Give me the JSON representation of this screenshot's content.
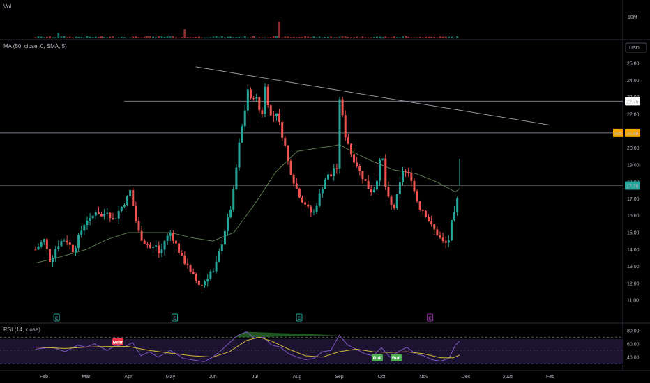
{
  "chart_data": {
    "type": "candlestick",
    "x_ticks": [
      "Feb",
      "Mar",
      "Apr",
      "May",
      "Jun",
      "Jul",
      "Aug",
      "Sep",
      "Oct",
      "Nov",
      "Dec",
      "2025",
      "Feb"
    ],
    "price_axis": {
      "unit_label": "USD",
      "ylim": [
        11.0,
        25.0
      ],
      "ticks": [
        "25.00",
        "24.00",
        "23.00",
        "22.00",
        "21.00",
        "20.00",
        "19.00",
        "18.00",
        "17.00",
        "16.00",
        "15.00",
        "14.00",
        "13.00",
        "12.00",
        "11.00"
      ]
    },
    "volume_pane": {
      "label": "Vol",
      "tick": "10M",
      "spikes_millions": [
        {
          "month_pos": 0.35,
          "value": 4.0
        },
        {
          "month_pos": 3.35,
          "value": 7.0
        },
        {
          "month_pos": 5.55,
          "value": 13.0
        },
        {
          "month_pos": 6.2,
          "value": 2.0
        },
        {
          "month_pos": 7.15,
          "value": 1.5
        },
        {
          "month_pos": 8.6,
          "value": 1.8
        }
      ]
    },
    "ma_legend": "MA (50, close, 0, SMA, 5)",
    "price_markers": [
      {
        "label": "22.76",
        "value": 22.76,
        "style": "white"
      },
      {
        "prefix": "Pre",
        "label": "20.89",
        "value": 20.89,
        "style": "orange"
      },
      {
        "label": "17.78",
        "value": 17.78,
        "style": "green"
      }
    ],
    "horizontal_lines": [
      22.76,
      20.89,
      17.78
    ],
    "trendline": {
      "start": {
        "month_pos": 3.6,
        "value": 24.8
      },
      "end": {
        "month_pos": 12.0,
        "value": 21.35
      }
    },
    "earnings_markers": [
      {
        "month_pos": 0.3,
        "label": "E",
        "color": "#26a69a"
      },
      {
        "month_pos": 3.1,
        "label": "E",
        "color": "#26a69a"
      },
      {
        "month_pos": 6.05,
        "label": "E",
        "color": "#26a69a"
      },
      {
        "month_pos": 9.15,
        "label": "E",
        "color": "#9c27b0"
      }
    ],
    "price_path": [
      [
        -0.2,
        14.0
      ],
      [
        0.0,
        14.6
      ],
      [
        0.15,
        13.3
      ],
      [
        0.3,
        14.2
      ],
      [
        0.45,
        14.6
      ],
      [
        0.55,
        14.5
      ],
      [
        0.7,
        13.9
      ],
      [
        0.85,
        14.9
      ],
      [
        1.0,
        15.8
      ],
      [
        1.1,
        15.7
      ],
      [
        1.25,
        16.4
      ],
      [
        1.35,
        15.9
      ],
      [
        1.5,
        16.3
      ],
      [
        1.65,
        15.7
      ],
      [
        1.8,
        16.4
      ],
      [
        1.95,
        16.9
      ],
      [
        2.05,
        17.5
      ],
      [
        2.15,
        16.0
      ],
      [
        2.25,
        15.0
      ],
      [
        2.35,
        14.5
      ],
      [
        2.45,
        14.3
      ],
      [
        2.55,
        14.0
      ],
      [
        2.65,
        14.3
      ],
      [
        2.75,
        13.6
      ],
      [
        2.85,
        14.5
      ],
      [
        3.0,
        15.0
      ],
      [
        3.1,
        14.5
      ],
      [
        3.2,
        13.9
      ],
      [
        3.3,
        13.3
      ],
      [
        3.4,
        13.2
      ],
      [
        3.45,
        12.6
      ],
      [
        3.55,
        12.4
      ],
      [
        3.65,
        12.0
      ],
      [
        3.75,
        11.9
      ],
      [
        3.85,
        12.3
      ],
      [
        3.95,
        12.7
      ],
      [
        4.05,
        12.6
      ],
      [
        4.1,
        13.4
      ],
      [
        4.2,
        14.2
      ],
      [
        4.3,
        15.3
      ],
      [
        4.4,
        16.1
      ],
      [
        4.5,
        17.5
      ],
      [
        4.6,
        19.7
      ],
      [
        4.65,
        20.6
      ],
      [
        4.75,
        22.0
      ],
      [
        4.85,
        23.8
      ],
      [
        4.9,
        22.8
      ],
      [
        5.0,
        23.2
      ],
      [
        5.1,
        22.3
      ],
      [
        5.15,
        21.6
      ],
      [
        5.25,
        23.8
      ],
      [
        5.3,
        22.8
      ],
      [
        5.4,
        21.6
      ],
      [
        5.5,
        22.3
      ],
      [
        5.6,
        21.2
      ],
      [
        5.7,
        20.3
      ],
      [
        5.8,
        19.0
      ],
      [
        5.9,
        18.2
      ],
      [
        6.0,
        17.5
      ],
      [
        6.1,
        17.0
      ],
      [
        6.2,
        16.7
      ],
      [
        6.3,
        16.2
      ],
      [
        6.4,
        16.2
      ],
      [
        6.5,
        17.0
      ],
      [
        6.6,
        17.7
      ],
      [
        6.7,
        18.4
      ],
      [
        6.8,
        18.3
      ],
      [
        6.85,
        18.9
      ],
      [
        6.95,
        18.6
      ],
      [
        7.0,
        23.0
      ],
      [
        7.05,
        22.7
      ],
      [
        7.1,
        21.0
      ],
      [
        7.2,
        20.4
      ],
      [
        7.3,
        19.5
      ],
      [
        7.4,
        19.1
      ],
      [
        7.5,
        18.5
      ],
      [
        7.6,
        18.1
      ],
      [
        7.7,
        17.6
      ],
      [
        7.8,
        17.4
      ],
      [
        7.9,
        18.3
      ],
      [
        8.0,
        19.7
      ],
      [
        8.05,
        19.0
      ],
      [
        8.1,
        17.6
      ],
      [
        8.2,
        16.6
      ],
      [
        8.3,
        16.5
      ],
      [
        8.4,
        17.4
      ],
      [
        8.5,
        18.7
      ],
      [
        8.6,
        18.5
      ],
      [
        8.7,
        18.3
      ],
      [
        8.8,
        17.2
      ],
      [
        8.9,
        16.5
      ],
      [
        9.0,
        16.3
      ],
      [
        9.1,
        15.8
      ],
      [
        9.2,
        15.3
      ],
      [
        9.3,
        15.0
      ],
      [
        9.4,
        14.6
      ],
      [
        9.5,
        14.3
      ],
      [
        9.6,
        14.6
      ],
      [
        9.65,
        15.5
      ],
      [
        9.75,
        16.2
      ],
      [
        9.85,
        17.78
      ]
    ],
    "ma_path": [
      [
        -0.2,
        13.2
      ],
      [
        0.3,
        13.5
      ],
      [
        1.0,
        14.0
      ],
      [
        1.5,
        14.6
      ],
      [
        2.0,
        15.0
      ],
      [
        2.5,
        15.0
      ],
      [
        3.0,
        15.0
      ],
      [
        3.5,
        14.7
      ],
      [
        4.0,
        14.5
      ],
      [
        4.5,
        15.0
      ],
      [
        5.0,
        16.7
      ],
      [
        5.5,
        18.6
      ],
      [
        6.0,
        19.8
      ],
      [
        6.5,
        20.0
      ],
      [
        6.8,
        20.1
      ],
      [
        7.0,
        20.2
      ],
      [
        7.3,
        19.8
      ],
      [
        7.8,
        19.2
      ],
      [
        8.3,
        18.7
      ],
      [
        8.8,
        18.5
      ],
      [
        9.3,
        18.0
      ],
      [
        9.75,
        17.4
      ],
      [
        9.85,
        17.6
      ]
    ],
    "rsi_pane": {
      "label": "RSI (14, close)",
      "ticks": [
        "80.00",
        "60.00",
        "40.00"
      ],
      "ylim": [
        20,
        90
      ],
      "bands": [
        70,
        30
      ],
      "badges": [
        {
          "month_pos": 1.75,
          "value": 63,
          "text": "Bear",
          "color": "#f23645"
        },
        {
          "month_pos": 7.9,
          "value": 39,
          "text": "Bull",
          "color": "#4caf50"
        },
        {
          "month_pos": 8.35,
          "value": 39,
          "text": "Bull",
          "color": "#4caf50"
        }
      ],
      "rsi_path": [
        [
          -0.2,
          52
        ],
        [
          0.2,
          55
        ],
        [
          0.5,
          48
        ],
        [
          0.8,
          58
        ],
        [
          1.0,
          55
        ],
        [
          1.2,
          60
        ],
        [
          1.5,
          50
        ],
        [
          1.7,
          58
        ],
        [
          1.9,
          55
        ],
        [
          2.1,
          62
        ],
        [
          2.3,
          42
        ],
        [
          2.5,
          48
        ],
        [
          2.7,
          40
        ],
        [
          3.0,
          50
        ],
        [
          3.3,
          38
        ],
        [
          3.6,
          35
        ],
        [
          3.8,
          33
        ],
        [
          4.0,
          40
        ],
        [
          4.2,
          50
        ],
        [
          4.4,
          62
        ],
        [
          4.6,
          73
        ],
        [
          4.8,
          78
        ],
        [
          5.0,
          68
        ],
        [
          5.2,
          70
        ],
        [
          5.4,
          58
        ],
        [
          5.6,
          55
        ],
        [
          5.8,
          45
        ],
        [
          6.0,
          40
        ],
        [
          6.2,
          36
        ],
        [
          6.4,
          38
        ],
        [
          6.6,
          48
        ],
        [
          6.8,
          50
        ],
        [
          7.0,
          73
        ],
        [
          7.2,
          58
        ],
        [
          7.4,
          52
        ],
        [
          7.6,
          45
        ],
        [
          7.8,
          42
        ],
        [
          8.0,
          54
        ],
        [
          8.2,
          40
        ],
        [
          8.4,
          48
        ],
        [
          8.6,
          55
        ],
        [
          8.8,
          45
        ],
        [
          9.0,
          42
        ],
        [
          9.2,
          36
        ],
        [
          9.4,
          34
        ],
        [
          9.6,
          38
        ],
        [
          9.75,
          58
        ],
        [
          9.85,
          64
        ]
      ],
      "signal_path": [
        [
          -0.2,
          55
        ],
        [
          0.5,
          53
        ],
        [
          1.0,
          55
        ],
        [
          1.5,
          56
        ],
        [
          2.0,
          56
        ],
        [
          2.5,
          50
        ],
        [
          3.0,
          46
        ],
        [
          3.5,
          42
        ],
        [
          4.0,
          40
        ],
        [
          4.4,
          48
        ],
        [
          4.8,
          65
        ],
        [
          5.1,
          70
        ],
        [
          5.4,
          64
        ],
        [
          5.8,
          52
        ],
        [
          6.2,
          42
        ],
        [
          6.6,
          40
        ],
        [
          7.0,
          48
        ],
        [
          7.4,
          52
        ],
        [
          7.8,
          48
        ],
        [
          8.2,
          47
        ],
        [
          8.6,
          48
        ],
        [
          9.0,
          45
        ],
        [
          9.4,
          39
        ],
        [
          9.7,
          39
        ],
        [
          9.85,
          43
        ]
      ]
    }
  }
}
